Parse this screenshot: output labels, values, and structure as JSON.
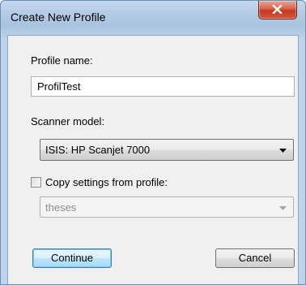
{
  "window": {
    "title": "Create New Profile",
    "close_icon": "close-icon"
  },
  "profile_name": {
    "label": "Profile name:",
    "value": "ProfilTest"
  },
  "scanner_model": {
    "label": "Scanner model:",
    "selected": "ISIS: HP Scanjet 7000"
  },
  "copy_settings": {
    "label": "Copy settings from profile:",
    "checked": false,
    "selected": "theses",
    "enabled": false
  },
  "buttons": {
    "continue_label": "Continue",
    "cancel_label": "Cancel"
  },
  "colors": {
    "titlebar": "#b7cde6",
    "close_button": "#c8371f",
    "default_button_border": "#3c7fb1",
    "client_bg": "#f0f0f0"
  }
}
